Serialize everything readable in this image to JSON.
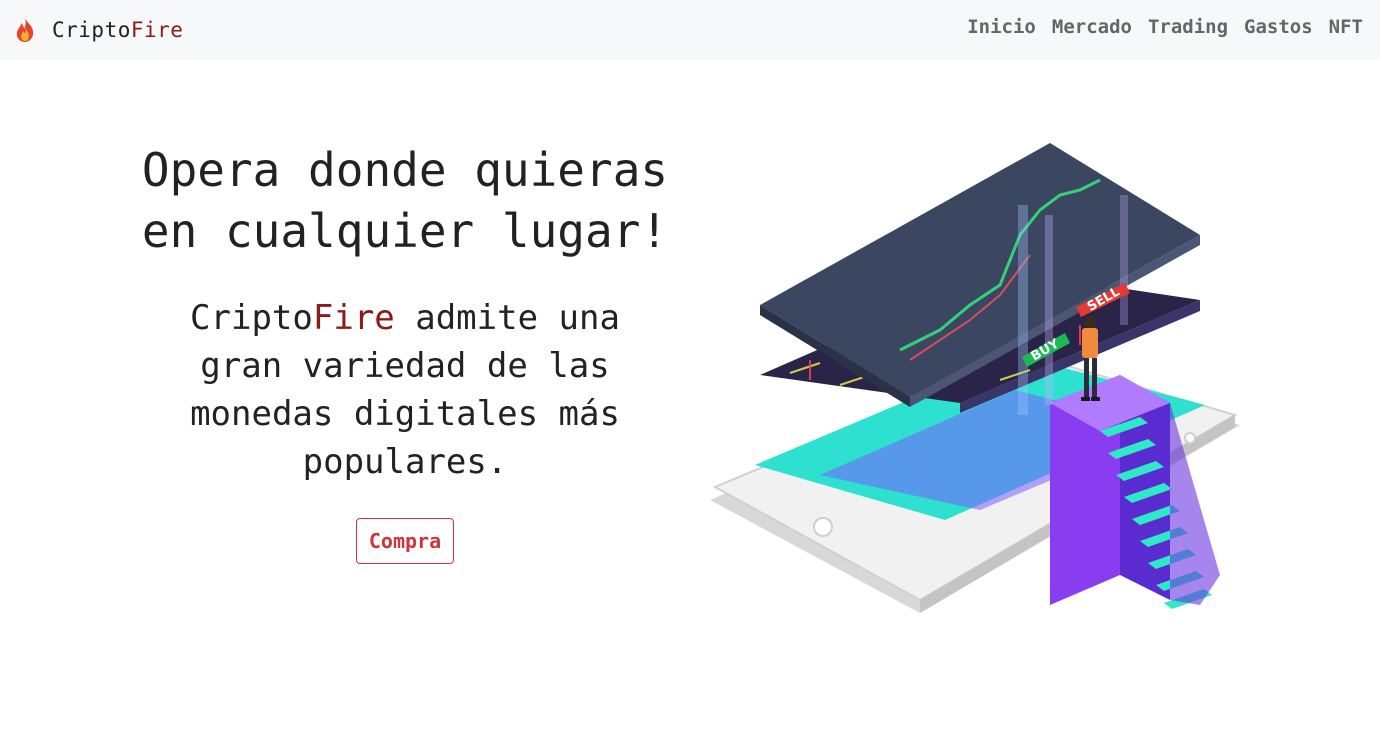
{
  "brand": {
    "name_part1": "Cripto",
    "name_part2": "Fire",
    "icon": "fire-icon",
    "accent_color": "#8b1a1a"
  },
  "nav": {
    "items": [
      {
        "label": "Inicio"
      },
      {
        "label": "Mercado"
      },
      {
        "label": "Trading"
      },
      {
        "label": "Gastos"
      },
      {
        "label": "NFT"
      }
    ]
  },
  "hero": {
    "headline_line1": "Opera donde quieras",
    "headline_line2": "en cualquier lugar!",
    "sub_brand_part1": "Cripto",
    "sub_brand_part2": "Fire",
    "sub_text": " admite una gran variedad de las monedas digitales más populares.",
    "button_label": "Compra",
    "button_color": "#d1343a"
  },
  "illustration": {
    "buy_label": "BUY",
    "sell_label": "SELL",
    "buy_color": "#1db954",
    "sell_color": "#e53935"
  }
}
